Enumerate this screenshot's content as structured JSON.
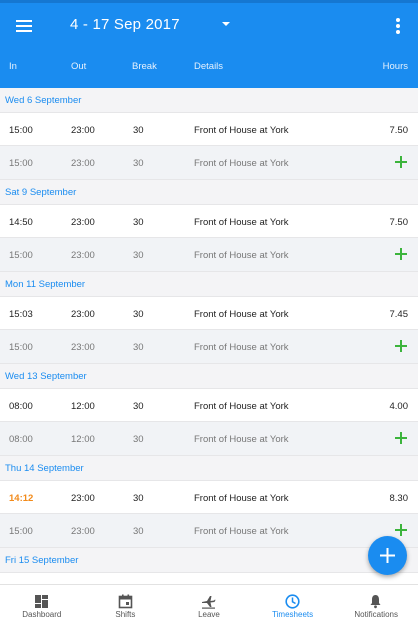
{
  "header": {
    "date_range": "4 - 17 Sep 2017",
    "columns": {
      "in": "In",
      "out": "Out",
      "break": "Break",
      "details": "Details",
      "hours": "Hours"
    }
  },
  "days": [
    {
      "label": "Wed 6 September",
      "entry": {
        "in": "15:00",
        "out": "23:00",
        "break": "30",
        "details": "Front of House at York",
        "hours": "7.50"
      },
      "template": {
        "in": "15:00",
        "out": "23:00",
        "break": "30",
        "details": "Front of House at York"
      }
    },
    {
      "label": "Sat 9 September",
      "entry": {
        "in": "14:50",
        "out": "23:00",
        "break": "30",
        "details": "Front of House at York",
        "hours": "7.50"
      },
      "template": {
        "in": "15:00",
        "out": "23:00",
        "break": "30",
        "details": "Front of House at York"
      }
    },
    {
      "label": "Mon 11 September",
      "entry": {
        "in": "15:03",
        "out": "23:00",
        "break": "30",
        "details": "Front of House at York",
        "hours": "7.45"
      },
      "template": {
        "in": "15:00",
        "out": "23:00",
        "break": "30",
        "details": "Front of House at York"
      }
    },
    {
      "label": "Wed 13 September",
      "entry": {
        "in": "08:00",
        "out": "12:00",
        "break": "30",
        "details": "Front of House at York",
        "hours": "4.00"
      },
      "template": {
        "in": "08:00",
        "out": "12:00",
        "break": "30",
        "details": "Front of House at York"
      }
    },
    {
      "label": "Thu 14 September",
      "entry": {
        "in": "14:12",
        "out": "23:00",
        "break": "30",
        "details": "Front of House at York",
        "hours": "8.30"
      },
      "template": {
        "in": "15:00",
        "out": "23:00",
        "break": "30",
        "details": "Front of House at York"
      }
    },
    {
      "label": "Fri 15 September"
    }
  ],
  "bottom_nav": [
    {
      "label": "Dashboard",
      "icon": "dashboard-icon"
    },
    {
      "label": "Shifts",
      "icon": "calendar-icon"
    },
    {
      "label": "Leave",
      "icon": "airplane-icon"
    },
    {
      "label": "Timesheets",
      "icon": "clock-icon",
      "active": true
    },
    {
      "label": "Notifications",
      "icon": "bell-icon"
    }
  ],
  "colors": {
    "primary": "#1a8cf0",
    "add_green": "#3cb43c",
    "late_orange": "#f28a1a"
  }
}
